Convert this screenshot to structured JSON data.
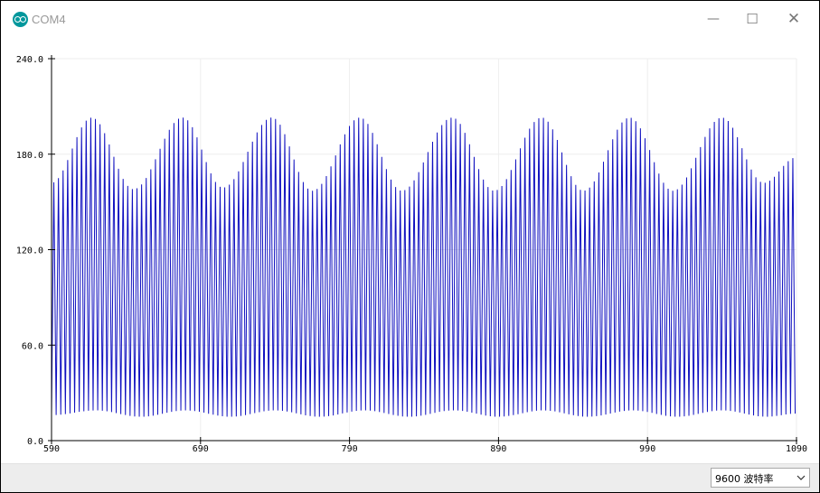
{
  "window": {
    "title": "COM4"
  },
  "controls": {
    "minimize": "—",
    "maximize": "☐",
    "close": "✕"
  },
  "baud": {
    "selected": "9600  波特率"
  },
  "colors": {
    "series": "#1010c0",
    "grid": "#eeeeee",
    "axis": "#000000"
  },
  "icons": [
    "arduino-logo-icon",
    "minimize-icon",
    "maximize-icon",
    "close-icon",
    "chevron-down-icon"
  ],
  "chart_data": {
    "type": "line",
    "title": "",
    "xlabel": "",
    "ylabel": "",
    "xlim": [
      590,
      1090
    ],
    "ylim": [
      0,
      240
    ],
    "grid": true,
    "x_ticks": [
      "590",
      "690",
      "790",
      "890",
      "990",
      "1090"
    ],
    "y_ticks": [
      "0.0",
      "60.0",
      "120.0",
      "180.0",
      "240.0"
    ],
    "series": [
      {
        "name": "",
        "description_visible": "alternating samples between a low trough and a high peak",
        "x_range": [
          590,
          1090
        ],
        "low_envelope": [
          [
            590,
            16
          ],
          [
            620,
            19
          ],
          [
            650,
            15
          ],
          [
            680,
            19
          ],
          [
            710,
            15
          ],
          [
            740,
            19
          ],
          [
            770,
            15
          ],
          [
            800,
            19
          ],
          [
            830,
            15
          ],
          [
            860,
            19
          ],
          [
            890,
            15
          ],
          [
            920,
            19
          ],
          [
            950,
            15
          ],
          [
            980,
            19
          ],
          [
            1010,
            15
          ],
          [
            1040,
            19
          ],
          [
            1070,
            15
          ],
          [
            1090,
            17
          ]
        ],
        "high_envelope": [
          [
            590,
            162
          ],
          [
            617,
            203
          ],
          [
            645,
            158
          ],
          [
            678,
            203
          ],
          [
            705,
            159
          ],
          [
            738,
            203
          ],
          [
            765,
            157
          ],
          [
            797,
            203
          ],
          [
            825,
            157
          ],
          [
            859,
            203
          ],
          [
            887,
            157
          ],
          [
            919,
            203
          ],
          [
            947,
            157
          ],
          [
            978,
            203
          ],
          [
            1007,
            157
          ],
          [
            1040,
            203
          ],
          [
            1068,
            162
          ],
          [
            1090,
            178
          ]
        ]
      }
    ]
  }
}
